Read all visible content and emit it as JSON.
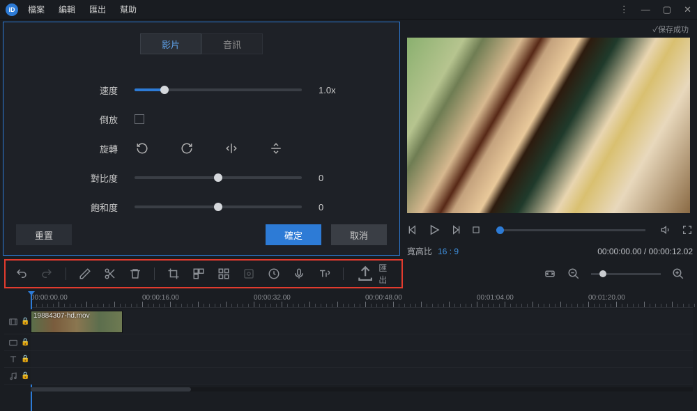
{
  "menu": {
    "file": "檔案",
    "edit": "編輯",
    "export": "匯出",
    "help": "幫助"
  },
  "panel": {
    "tabs": {
      "video": "影片",
      "audio": "音訊"
    },
    "speed": {
      "label": "速度",
      "value": "1.0x",
      "pos": 18
    },
    "reverse": {
      "label": "倒放"
    },
    "rotate": {
      "label": "旋轉"
    },
    "contrast": {
      "label": "對比度",
      "value": "0",
      "pos": 50
    },
    "saturation": {
      "label": "飽和度",
      "value": "0",
      "pos": 50
    },
    "reset": "重置",
    "ok": "確定",
    "cancel": "取消"
  },
  "preview": {
    "save_status": "✓保存成功",
    "aspect_label": "寬高比",
    "aspect_value": "16 : 9",
    "time": "00:00:00.00 / 00:00:12.02"
  },
  "toolbar": {
    "export": "匯出"
  },
  "timeline": {
    "marks": [
      "00:00:00.00",
      "00:00:16.00",
      "00:00:32.00",
      "00:00:48.00",
      "00:01:04.00",
      "00:01:20.00"
    ],
    "clip_name": "19884307-hd.mov"
  }
}
